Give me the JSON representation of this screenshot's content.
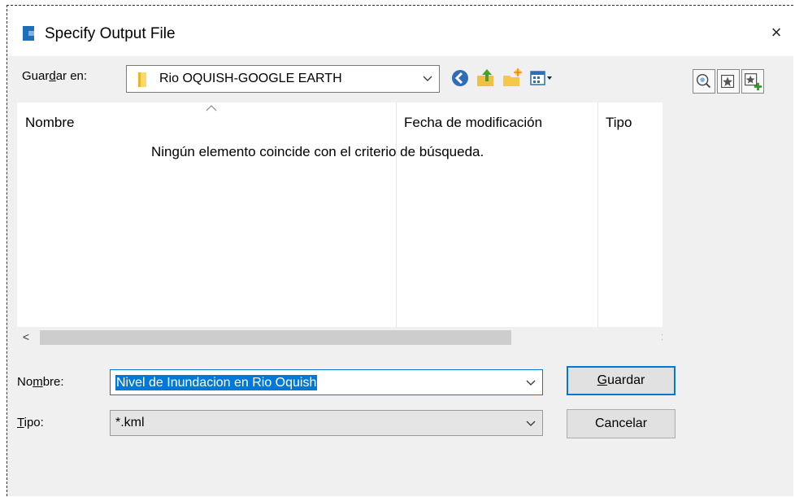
{
  "window": {
    "title": "Specify Output File",
    "close_label": "×"
  },
  "save_in": {
    "label_pre": "Guar",
    "label_accel": "d",
    "label_post": "ar en:",
    "value": "Rio OQUISH-GOOGLE EARTH"
  },
  "toolbar": {
    "icons": [
      "back-icon",
      "up-folder-icon",
      "new-folder-icon",
      "view-menu-icon"
    ],
    "side_icons": [
      "search-network-icon",
      "add-favorite-icon",
      "add-bookmark-icon"
    ]
  },
  "file_list": {
    "columns": [
      "Nombre",
      "Fecha de modificación",
      "Tipo"
    ],
    "empty_message": "Ningún elemento coincide con el criterio de búsqueda.",
    "scroll_left": "<",
    "scroll_right": ">"
  },
  "name_field": {
    "label_pre": "No",
    "label_accel": "m",
    "label_post": "bre:",
    "value": "Nivel de Inundacion en Rio Oquish"
  },
  "type_field": {
    "label_accel": "T",
    "label_post": "ipo:",
    "value": "*.kml"
  },
  "buttons": {
    "save_accel": "G",
    "save_rest": "uardar",
    "cancel": "Cancelar"
  },
  "colors": {
    "accent": "#0078d7",
    "dialog_bg": "#f0f0f0"
  }
}
